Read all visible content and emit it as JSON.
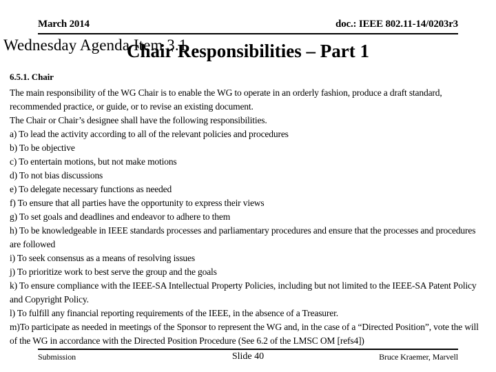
{
  "header": {
    "date": "March 2014",
    "doc_id": "doc.: IEEE 802.11-14/0203r3"
  },
  "title_block": {
    "agenda_line": "Wednesday Agenda Item 3.1",
    "title": "Chair  Responsibilities – Part 1"
  },
  "body": {
    "section_heading": "6.5.1. Chair",
    "paragraphs": [
      "The main responsibility of the WG Chair is to enable the WG to operate in an orderly fashion, produce a draft standard, recommended practice, or guide, or to revise an existing document.",
      "The Chair or Chair’s designee shall have the following responsibilities.",
      "a) To lead the activity according to all of the relevant policies and procedures",
      "b) To be objective",
      "c) To entertain motions, but not make motions",
      "d) To not bias discussions",
      "e) To delegate necessary functions as needed",
      "f) To ensure that all parties have the opportunity to express their views",
      "g) To set goals and deadlines and endeavor to adhere to them",
      "h) To be knowledgeable in IEEE standards processes and parliamentary procedures and ensure that the processes and procedures are followed",
      "i) To seek consensus as a means of resolving issues",
      "j) To prioritize work to best serve the group and the goals",
      "k) To ensure compliance with the IEEE-SA Intellectual Property Policies, including but not limited to the IEEE-SA Patent Policy and Copyright Policy.",
      "l) To fulfill any financial reporting requirements of the IEEE, in the absence of a Treasurer.",
      "m)To participate as needed in meetings of the Sponsor to represent the WG and, in the case of a “Directed Position”, vote the will of the WG in accordance with the Directed Position Procedure (See 6.2 of the LMSC OM [refs4])"
    ]
  },
  "footer": {
    "left": "Submission",
    "center": "Slide 40",
    "right": "Bruce Kraemer, Marvell"
  },
  "colors": {
    "text": "#000000",
    "background": "#ffffff",
    "rule": "#000000"
  }
}
